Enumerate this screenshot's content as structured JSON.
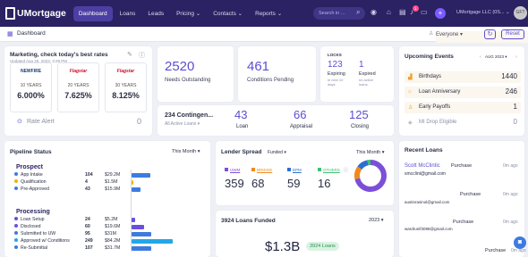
{
  "nav": {
    "brand": "UMortgage",
    "items": [
      "Dashboard",
      "Loans",
      "Leads",
      "Pricing ⌄",
      "Contacts ⌄",
      "Reports ⌄"
    ],
    "search_placeholder": "Search in ...",
    "notif_count": "1",
    "org": "UMortgage LLC (0S... ⌄",
    "avatar": "GFT"
  },
  "subbar": {
    "title": "Dashboard",
    "everyone": "Everyone ▾",
    "reset": "Reset"
  },
  "marketing": {
    "title": "Marketing, check today's best rates",
    "updated": "Updated Aug 26, 2023, 3:29 PM",
    "rates": [
      {
        "lender": "NEWFIRE",
        "years": "10 YEARS",
        "rate": "6.000%"
      },
      {
        "lender": "Flagstar",
        "years": "20 YEARS",
        "rate": "7.625%"
      },
      {
        "lender": "Flagstar",
        "years": "30 YEARS",
        "rate": "8.125%"
      }
    ],
    "alert_label": "Rate Alert",
    "alert_count": "0"
  },
  "needs": {
    "value": "2520",
    "label": "Needs Outstanding"
  },
  "conditions": {
    "value": "461",
    "label": "Conditions Pending"
  },
  "locks": {
    "title": "LOCKS",
    "expiring_value": "123",
    "expiring_label": "Expiring",
    "expiring_sub": "in next 10 days",
    "expired_value": "1",
    "expired_label": "Expired",
    "expired_sub": "no active loans"
  },
  "contingencies": {
    "title": "234 Contingen...",
    "sub": "All Active Loans ▾",
    "loan_value": "43",
    "loan_label": "Loan",
    "appraisal_value": "66",
    "appraisal_label": "Appraisal",
    "closing_value": "125",
    "closing_label": "Closing"
  },
  "events": {
    "title": "Upcoming Events",
    "period": "AUG 2023 ▾",
    "items": [
      {
        "label": "Birthdays",
        "count": "1440"
      },
      {
        "label": "Loan Anniversary",
        "count": "246"
      },
      {
        "label": "Early Payoffs",
        "count": "1"
      },
      {
        "label": "MI Drop Eligible",
        "count": "0"
      }
    ]
  },
  "pipeline": {
    "title": "Pipeline Status",
    "period": "This Month ▾",
    "groups": [
      {
        "name": "Prospect",
        "rows": [
          {
            "label": "App Intake",
            "count": "104",
            "amount": "$29.2M",
            "frac": 0.45,
            "color": "#3d7be0"
          },
          {
            "label": "Qualification",
            "count": "4",
            "amount": "$1.5M",
            "frac": 0.03,
            "color": "#f0b400"
          },
          {
            "label": "Pre-Approved",
            "count": "43",
            "amount": "$15.9M",
            "frac": 0.22,
            "color": "#3d7be0"
          }
        ]
      },
      {
        "name": "Processing",
        "rows": [
          {
            "label": "Loan Setup",
            "count": "24",
            "amount": "$5.2M",
            "frac": 0.08,
            "color": "#6a4ee0"
          },
          {
            "label": "Disclosed",
            "count": "60",
            "amount": "$19.6M",
            "frac": 0.3,
            "color": "#6a4ee0"
          },
          {
            "label": "Submitted to UW",
            "count": "95",
            "amount": "$31M",
            "frac": 0.47,
            "color": "#3d7be0"
          },
          {
            "label": "Approved w/ Conditions",
            "count": "249",
            "amount": "$84.2M",
            "frac": 1.0,
            "color": "#22a7e8"
          },
          {
            "label": "Re-Submittal",
            "count": "107",
            "amount": "$31.7M",
            "frac": 0.48,
            "color": "#3d7be0"
          }
        ]
      }
    ]
  },
  "spread": {
    "title": "Lender Spread",
    "filter": "Funded ▾",
    "period": "This Month ▾",
    "items": [
      {
        "label": "UWM",
        "value": "359",
        "color": "#7c4fd8"
      },
      {
        "label": "BRIDGE",
        "value": "68",
        "color": "#f08a1c"
      },
      {
        "label": "EPM",
        "value": "59",
        "color": "#2d6fd0"
      },
      {
        "label": "OTHERS",
        "value": "16",
        "color": "#3fbf70"
      }
    ]
  },
  "funded": {
    "title": "3924 Loans Funded",
    "year": "2023 ▾",
    "amount": "$1.3B",
    "count": "3924 Loans"
  },
  "recent": {
    "title": "Recent Loans",
    "items": [
      {
        "name": "Scott McClintic",
        "type": "Purchase",
        "email": "smcclint@gmail.com",
        "time": "0m ago"
      },
      {
        "name": "",
        "type": "Purchase",
        "email": "austinrasinol@gmail.com",
        "time": "0m ago"
      },
      {
        "name": "",
        "type": "Purchase",
        "email": "wardrunif3098@gmail.com",
        "time": "0m ago"
      },
      {
        "name": "",
        "type": "Purchase",
        "email": "",
        "time": "0m ago"
      }
    ]
  },
  "colors": {
    "topbar": "#2a2262",
    "accent": "#5b4ed1",
    "green": "#3fbf70"
  }
}
